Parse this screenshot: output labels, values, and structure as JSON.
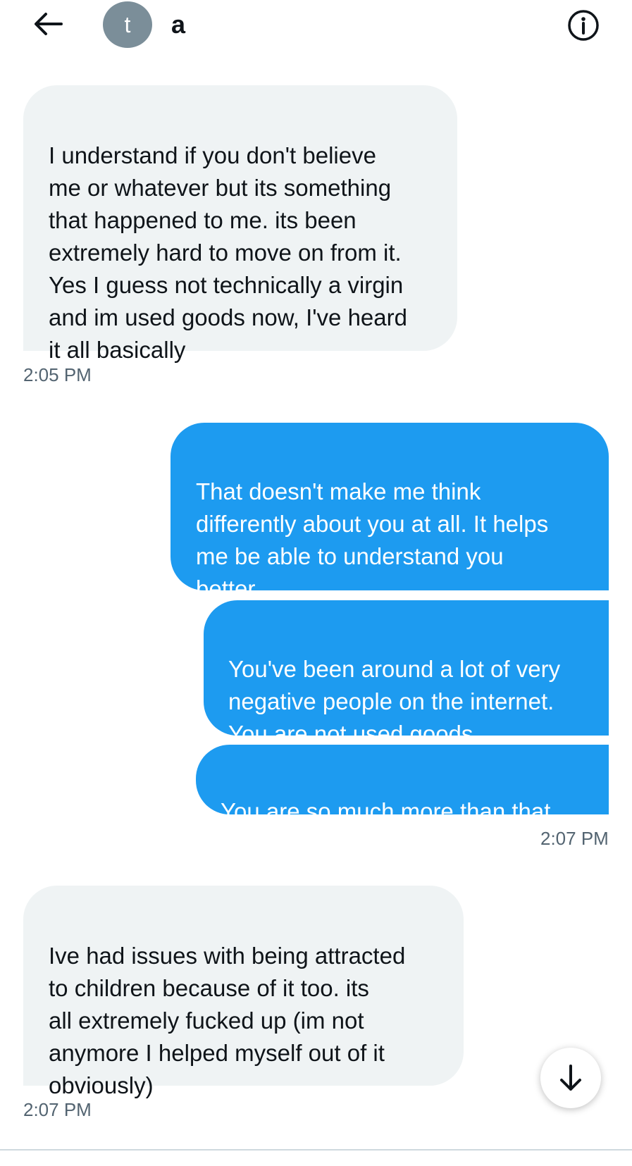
{
  "header": {
    "avatar_initial": "t",
    "contact_name": "a"
  },
  "messages": [
    {
      "text": "I understand if you don't believe\nme or whatever but its something\nthat happened to me. its been\nextremely hard to move on from it.\nYes I guess not technically a virgin\nand im used goods now, I've heard\nit all basically"
    },
    {
      "text": "That doesn't make me think\ndifferently about you at all. It helps\nme be able to understand you\nbetter."
    },
    {
      "text": "You've been around a lot of very\nnegative people on the internet.\nYou are not used goods."
    },
    {
      "text": "You are so much more than that."
    },
    {
      "text": "Ive had issues with being attracted\nto children because of it too. its\nall extremely fucked up (im not\nanymore I helped myself out of it\nobviously)"
    }
  ],
  "timestamps": [
    "2:05 PM",
    "2:07 PM",
    "2:07 PM"
  ],
  "icons": {
    "back": "back-arrow-icon",
    "info": "info-icon",
    "scroll_down": "arrow-down-icon"
  },
  "colors": {
    "sent_bubble": "#1d9bf0",
    "received_bubble": "#eff3f4",
    "timestamp": "#536471",
    "avatar_bg": "#7b8e99"
  }
}
